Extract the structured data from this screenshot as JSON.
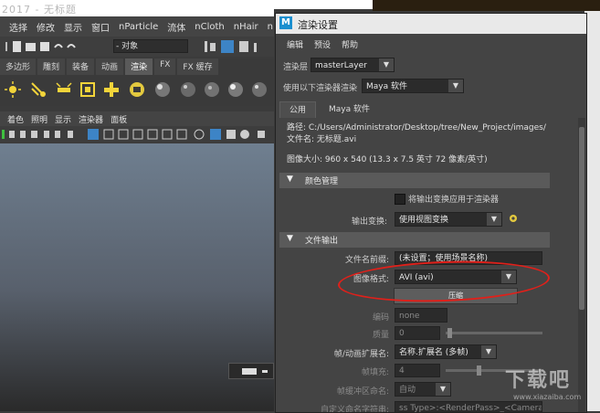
{
  "maya": {
    "title": "2017 - 无标题",
    "menus": [
      "选择",
      "修改",
      "显示",
      "窗口",
      "nParticle",
      "流体",
      "nCloth",
      "nHair",
      "n"
    ],
    "object_field": "- 对象",
    "shelf_tabs": [
      "多边形",
      "雕刻",
      "装备",
      "动画",
      "渲染",
      "FX",
      "FX 缓存"
    ],
    "selected_shelf_tab": "渲染",
    "panel_menus": [
      "着色",
      "照明",
      "显示",
      "渲染器",
      "面板"
    ],
    "watermark": "下载吧",
    "watermark_url": "www.xiazaiba.com"
  },
  "dialog": {
    "title": "渲染设置",
    "menus": [
      "编辑",
      "预设",
      "帮助"
    ],
    "render_layer_label": "渲染层",
    "render_layer_value": "masterLayer",
    "renderer_label": "使用以下渲染器渲染",
    "renderer_value": "Maya 软件",
    "tabs": [
      "公用",
      "Maya 软件"
    ],
    "path_line": "路径: C:/Users/Administrator/Desktop/tree/New_Project/images/",
    "filename_line": "文件名: 无标题.avi",
    "image_size_line": "图像大小: 960 x 540 (13.3 x 7.5 英寸 72 像素/英寸)",
    "color_section": "颜色管理",
    "apply_transform_label": "将输出变换应用于渲染器",
    "output_transform_label": "输出变换:",
    "output_transform_value": "使用视图变换",
    "file_output_section": "文件输出",
    "file_prefix_label": "文件名前缀:",
    "file_prefix_value": "(未设置；使用场景名称)",
    "image_format_label": "图像格式:",
    "image_format_value": "AVI (avi)",
    "codec_button": "压缩",
    "encoding_label": "编码",
    "encoding_value": "none",
    "quality_label": "质量",
    "quality_value": "0",
    "frame_ext_label": "帧/动画扩展名:",
    "frame_ext_value": "名称.扩展名 (多帧)",
    "frame_padding_label": "帧填充:",
    "frame_padding_value": "4",
    "frame_buffer_label": "帧缓冲区命名:",
    "frame_buffer_value": "自动",
    "custom_naming_label": "自定义命名字符串:",
    "custom_naming_value": "ss Type>:<RenderPass>_<Camera"
  },
  "colors": {
    "annotation_red": "#e0201a",
    "maya_logo_blue": "#1a8fcf"
  }
}
